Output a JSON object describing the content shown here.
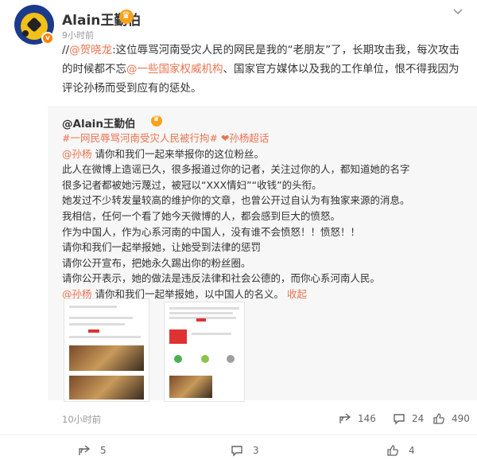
{
  "post": {
    "username": "Alain王勤伯",
    "time": "9小时前",
    "source": "",
    "content": {
      "prefix": "//",
      "mention1": "@贺晓龙",
      "part1": ":这位辱骂河南受灾人民的网民是我的“老朋友”了，长期攻击我，每次攻击的时候都不忘",
      "mention2": "@一些国家权威机构",
      "part2": "、国家官方媒体以及我的工作单位，恨不得我因为评论孙杨而受到应有的惩处。"
    }
  },
  "repost": {
    "username": "@Alain王勤伯",
    "tags": "#一网民辱骂河南受灾人民被行拘# ❤孙杨超话",
    "lines": [
      {
        "mention": "@孙杨",
        "text": " 请你和我们一起来举报你的这位粉丝。"
      },
      {
        "mention": "",
        "text": "此人在微博上造谣已久，很多报道过你的记者，关注过你的人，都知道她的名字"
      },
      {
        "mention": "",
        "text": "很多记者都被她污蔑过，被冠以“XXX情妇”“收钱”的头衔。"
      },
      {
        "mention": "",
        "text": "她发过不少转发量较高的维护你的文章，也曾公开过自认为有独家来源的消息。"
      },
      {
        "mention": "",
        "text": "我相信，任何一个看了她今天微博的人，都会感到巨大的愤怒。"
      },
      {
        "mention": "",
        "text": "作为中国人，作为心系河南的中国人，没有谁不会愤怒！！愤怒！！"
      },
      {
        "mention": "",
        "text": "请你和我们一起举报她，让她受到法律的惩罚"
      },
      {
        "mention": "",
        "text": "请你公开宣布，把她永久踢出你的粉丝圈。"
      },
      {
        "mention": "",
        "text": "请你公开表示，她的做法是违反法律和社会公德的，而你心系河南人民。"
      },
      {
        "mention": "@孙杨",
        "text": " 请你和我们一起举报她，以中国人的名义。",
        "link": "收起"
      }
    ]
  },
  "stats": {
    "time": "10小时前",
    "share": "146",
    "comment": "24",
    "like": "490"
  },
  "sub_stats": {
    "share": "5",
    "comment": "3",
    "like": "4"
  },
  "colors": {
    "accent": "#eb7350",
    "badge": "#ff8200"
  }
}
